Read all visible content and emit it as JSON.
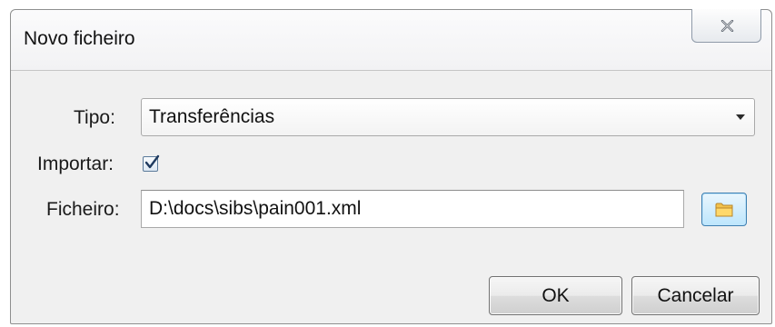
{
  "window": {
    "title": "Novo ficheiro"
  },
  "form": {
    "tipo_label": "Tipo:",
    "tipo_value": "Transferências",
    "importar_label": "Importar:",
    "importar_checked": true,
    "ficheiro_label": "Ficheiro:",
    "ficheiro_value": "D:\\docs\\sibs\\pain001.xml"
  },
  "buttons": {
    "ok_label": "OK",
    "cancel_label": "Cancelar"
  },
  "icons": {
    "close": "close-icon",
    "dropdown": "chevron-down-icon",
    "checkmark": "checkmark-icon",
    "browse": "folder-icon"
  }
}
